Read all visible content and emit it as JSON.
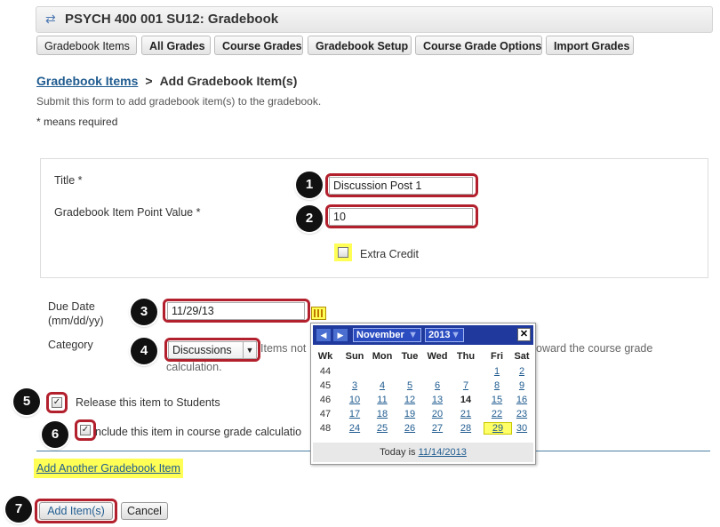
{
  "header": {
    "title": "PSYCH 400 001 SU12: Gradebook",
    "help_icon": "?"
  },
  "nav": [
    "Gradebook Items",
    "All Grades",
    "Course Grades",
    "Gradebook Setup",
    "Course Grade Options",
    "Import Grades"
  ],
  "breadcrumb": {
    "link": "Gradebook Items",
    "separator": ">",
    "current": "Add Gradebook Item(s)"
  },
  "instructions": "Submit this form to add gradebook item(s) to the gradebook.",
  "required_note": "* means required",
  "form": {
    "title_label": "Title *",
    "title_value": "Discussion Post 1",
    "points_label": "Gradebook Item Point Value *",
    "points_value": "10",
    "extra_credit_label": "Extra Credit",
    "due_date_label_1": "Due Date",
    "due_date_label_2": "(mm/dd/yy)",
    "due_date_value": "11/29/13",
    "category_label": "Category",
    "category_value": "Discussions",
    "category_note_left": "Items not",
    "category_note_right": "oward the course grade",
    "category_note_line2": "calculation.",
    "release_label": "Release this item to Students",
    "include_label": "nclude this item in course grade calculatio"
  },
  "markers": [
    "1",
    "2",
    "3",
    "4",
    "5",
    "6",
    "7"
  ],
  "calendar": {
    "month": "November",
    "year": "2013",
    "headers": [
      "Wk",
      "Sun",
      "Mon",
      "Tue",
      "Wed",
      "Thu",
      "Fri",
      "Sat"
    ],
    "weeks": [
      {
        "wk": "44",
        "days": [
          "",
          "",
          "",
          "",
          "",
          "1",
          "2"
        ]
      },
      {
        "wk": "45",
        "days": [
          "3",
          "4",
          "5",
          "6",
          "7",
          "8",
          "9"
        ]
      },
      {
        "wk": "46",
        "days": [
          "10",
          "11",
          "12",
          "13",
          "14",
          "15",
          "16"
        ]
      },
      {
        "wk": "47",
        "days": [
          "17",
          "18",
          "19",
          "20",
          "21",
          "22",
          "23"
        ]
      },
      {
        "wk": "48",
        "days": [
          "24",
          "25",
          "26",
          "27",
          "28",
          "29",
          "30"
        ]
      }
    ],
    "today_day": "14",
    "selected_day": "29",
    "today_prefix": "Today is",
    "today_date": "11/14/2013",
    "close": "✕"
  },
  "links": {
    "add_another": "Add Another Gradebook Item"
  },
  "buttons": {
    "add": "Add Item(s)",
    "cancel": "Cancel"
  },
  "colors": {
    "highlight_red": "#b3202d",
    "highlight_yellow": "#ffff55",
    "calendar_header": "#1f3a9c",
    "link": "#1f5b8f"
  }
}
